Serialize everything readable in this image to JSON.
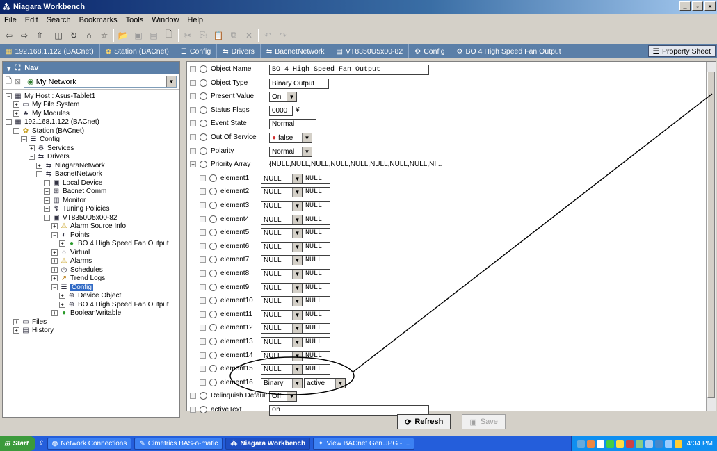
{
  "window": {
    "title": "Niagara Workbench"
  },
  "menu": [
    "File",
    "Edit",
    "Search",
    "Bookmarks",
    "Tools",
    "Window",
    "Help"
  ],
  "path": {
    "crumbs": [
      "192.168.1.122 (BACnet)",
      "Station (BACnet)",
      "Config",
      "Drivers",
      "BacnetNetwork",
      "VT8350U5x00-82",
      "Config",
      "BO 4 High Speed Fan Output"
    ],
    "view_label": "Property Sheet"
  },
  "nav": {
    "title": "Nav",
    "network_select": "My Network",
    "tree": [
      {
        "label": "My Host : Asus-Tablet1",
        "exp": "−",
        "icon": "host-icon"
      },
      {
        "label": "My File System",
        "exp": "+",
        "icon": "folder-icon"
      },
      {
        "label": "My Modules",
        "exp": "+",
        "icon": "modules-icon"
      },
      {
        "label": "192.168.1.122 (BACnet)",
        "exp": "−",
        "icon": "host-icon"
      },
      {
        "label": "Station (BACnet)",
        "exp": "−",
        "icon": "station-icon"
      },
      {
        "label": "Config",
        "exp": "−",
        "icon": "config-icon"
      },
      {
        "label": "Services",
        "exp": "+",
        "icon": "services-icon"
      },
      {
        "label": "Drivers",
        "exp": "−",
        "icon": "drivers-icon"
      },
      {
        "label": "NiagaraNetwork",
        "exp": "+",
        "icon": "network-icon"
      },
      {
        "label": "BacnetNetwork",
        "exp": "−",
        "icon": "network-icon"
      },
      {
        "label": "Local Device",
        "exp": "+",
        "icon": "device-icon"
      },
      {
        "label": "Bacnet Comm",
        "exp": "+",
        "icon": "comm-icon"
      },
      {
        "label": "Monitor",
        "exp": "+",
        "icon": "monitor-icon"
      },
      {
        "label": "Tuning Policies",
        "exp": "+",
        "icon": "tuning-icon"
      },
      {
        "label": "VT8350U5x00-82",
        "exp": "−",
        "icon": "device-icon"
      },
      {
        "label": "Alarm Source Info",
        "exp": "+",
        "icon": "alarm-icon"
      },
      {
        "label": "Points",
        "exp": "−",
        "icon": "points-icon"
      },
      {
        "label": "BO 4 High Speed Fan Output",
        "exp": "+",
        "icon": "point-icon"
      },
      {
        "label": "Virtual",
        "exp": "+",
        "icon": "virtual-icon"
      },
      {
        "label": "Alarms",
        "exp": "+",
        "icon": "alarm-icon"
      },
      {
        "label": "Schedules",
        "exp": "+",
        "icon": "schedule-icon"
      },
      {
        "label": "Trend Logs",
        "exp": "+",
        "icon": "trend-icon"
      },
      {
        "label": "Config",
        "exp": "−",
        "icon": "config-icon",
        "selected": true
      },
      {
        "label": "Device Object",
        "exp": "+",
        "icon": "object-icon"
      },
      {
        "label": "BO 4 High Speed Fan Output",
        "exp": "+",
        "icon": "object-icon"
      },
      {
        "label": "BooleanWritable",
        "exp": "+",
        "icon": "point-icon"
      },
      {
        "label": "Files",
        "exp": "+",
        "icon": "folder-icon"
      },
      {
        "label": "History",
        "exp": "+",
        "icon": "history-icon"
      }
    ]
  },
  "props": {
    "object_name": {
      "label": "Object Name",
      "value": "BO 4 High Speed Fan Output"
    },
    "object_type": {
      "label": "Object Type",
      "value": "Binary Output"
    },
    "present_value": {
      "label": "Present Value",
      "value": "On"
    },
    "status_flags": {
      "label": "Status Flags",
      "value": "0000",
      "marker": "¥"
    },
    "event_state": {
      "label": "Event State",
      "value": "Normal"
    },
    "out_of_service": {
      "label": "Out Of Service",
      "value": "false"
    },
    "polarity": {
      "label": "Polarity",
      "value": "Normal"
    },
    "priority_array": {
      "label": "Priority Array",
      "value": "{NULL,NULL,NULL,NULL,NULL,NULL,NULL,NULL,NI..."
    },
    "elements": [
      {
        "label": "element1",
        "type": "NULL",
        "value": "NULL"
      },
      {
        "label": "element2",
        "type": "NULL",
        "value": "NULL"
      },
      {
        "label": "element3",
        "type": "NULL",
        "value": "NULL"
      },
      {
        "label": "element4",
        "type": "NULL",
        "value": "NULL"
      },
      {
        "label": "element5",
        "type": "NULL",
        "value": "NULL"
      },
      {
        "label": "element6",
        "type": "NULL",
        "value": "NULL"
      },
      {
        "label": "element7",
        "type": "NULL",
        "value": "NULL"
      },
      {
        "label": "element8",
        "type": "NULL",
        "value": "NULL"
      },
      {
        "label": "element9",
        "type": "NULL",
        "value": "NULL"
      },
      {
        "label": "element10",
        "type": "NULL",
        "value": "NULL"
      },
      {
        "label": "element11",
        "type": "NULL",
        "value": "NULL"
      },
      {
        "label": "element12",
        "type": "NULL",
        "value": "NULL"
      },
      {
        "label": "element13",
        "type": "NULL",
        "value": "NULL"
      },
      {
        "label": "element14",
        "type": "NULL",
        "value": "NULL"
      },
      {
        "label": "element15",
        "type": "NULL",
        "value": "NULL"
      }
    ],
    "element16": {
      "label": "element16",
      "type": "Binary",
      "value": "active"
    },
    "relinquish_default": {
      "label": "Relinquish Default",
      "value": "Off"
    },
    "active_text": {
      "label": "activeText",
      "value": "On"
    }
  },
  "buttons": {
    "refresh": "Refresh",
    "save": "Save"
  },
  "taskbar": {
    "start": "Start",
    "tasks": [
      "Network Connections",
      "Cimetrics BAS-o-matic",
      "Niagara Workbench",
      "View BACnet Gen.JPG - ..."
    ],
    "clock": "4:34 PM"
  },
  "colors": {
    "titlebar": "#0a246a",
    "pathbar": "#5b7fa8",
    "taskbar": "#245edb",
    "selection": "#316ac5",
    "annotation": "#000000"
  }
}
